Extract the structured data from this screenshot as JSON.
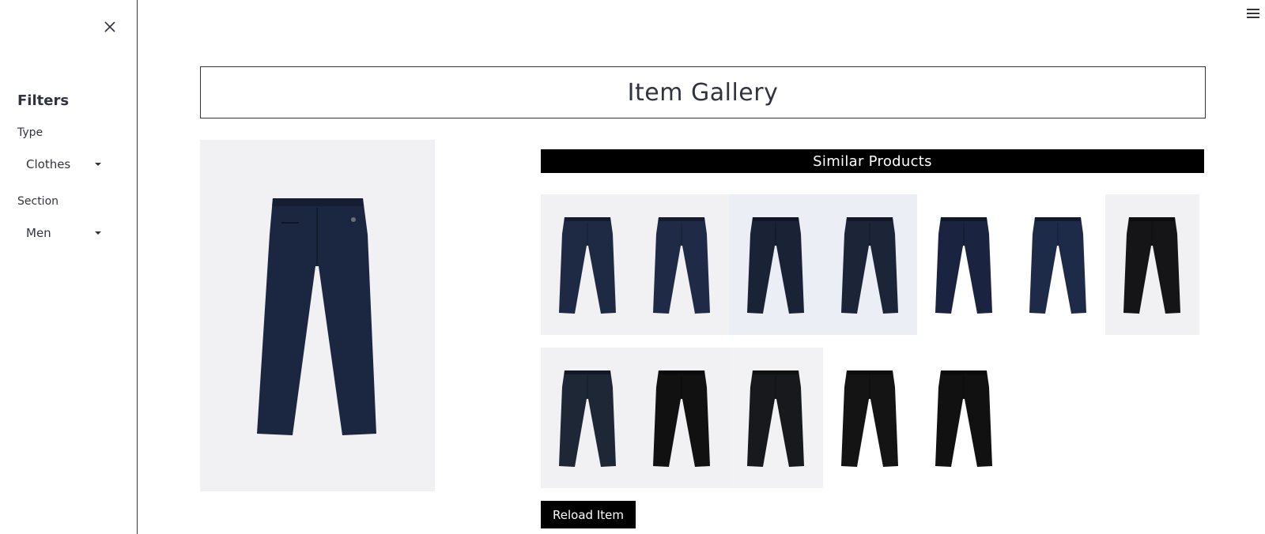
{
  "sidebar": {
    "title": "Filters",
    "type_label": "Type",
    "type_value": "Clothes",
    "section_label": "Section",
    "section_value": "Men"
  },
  "header": {
    "title": "Item Gallery"
  },
  "similar": {
    "title": "Similar Products",
    "row1": [
      {
        "color": "#1e2a44",
        "bg": "#f1f1f4"
      },
      {
        "color": "#1f2b46",
        "bg": "#f1f1f4"
      },
      {
        "color": "#1a2236",
        "bg": "#eceef5"
      },
      {
        "color": "#1c2438",
        "bg": "#eceef5"
      },
      {
        "color": "#1a2440",
        "bg": "#ffffff"
      },
      {
        "color": "#1d2a48",
        "bg": "#ffffff"
      },
      {
        "color": "#151517",
        "bg": "#f1f1f4"
      }
    ],
    "row2": [
      {
        "color": "#1d2736",
        "bg": "#f1f1f4"
      },
      {
        "color": "#111111",
        "bg": "#f1f1f4"
      },
      {
        "color": "#18191c",
        "bg": "#f2f2f5"
      },
      {
        "color": "#141414",
        "bg": "#ffffff"
      },
      {
        "color": "#111111",
        "bg": "#ffffff"
      }
    ]
  },
  "main_item": {
    "color": "#1b2640"
  },
  "actions": {
    "reload_label": "Reload Item"
  }
}
